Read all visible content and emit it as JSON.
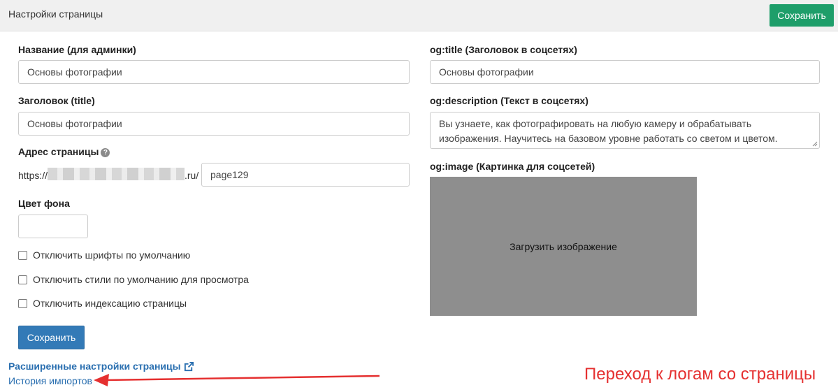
{
  "header": {
    "title": "Настройки страницы",
    "save_label": "Сохранить"
  },
  "left": {
    "name_label": "Название (для админки)",
    "name_value": "Основы фотографии",
    "title_label": "Заголовок (title)",
    "title_value": "Основы фотографии",
    "address_label": "Адрес страницы",
    "address_help_icon": "question-circle-icon",
    "url_prefix": "https://",
    "url_suffix": ".ru/",
    "slug_value": "page129",
    "bg_color_label": "Цвет фона",
    "bg_color_value": "",
    "checkboxes": [
      {
        "label": "Отключить шрифты по умолчанию",
        "checked": false
      },
      {
        "label": "Отключить стили по умолчанию для просмотра",
        "checked": false
      },
      {
        "label": "Отключить индексацию страницы",
        "checked": false
      }
    ],
    "save_label": "Сохранить"
  },
  "right": {
    "og_title_label": "og:title (Заголовок в соцсетях)",
    "og_title_value": "Основы фотографии",
    "og_description_label": "og:description (Текст в соцсетях)",
    "og_description_value": "Вы узнаете, как фотографировать на любую камеру и обрабатывать изображения. Научитесь на базовом уровне работать со светом и цветом.",
    "og_image_label": "og:image (Картинка для соцсетей)",
    "upload_label": "Загрузить изображение"
  },
  "links": {
    "advanced_settings": "Расширенные настройки страницы",
    "advanced_icon": "external-link-icon",
    "import_history": "История импортов"
  },
  "annotation": {
    "text": "Переход к логам со страницы",
    "color": "#e53030"
  },
  "colors": {
    "header_save": "#1e9e6a",
    "primary_button": "#337ab7",
    "link": "#2a6fb0",
    "image_placeholder": "#8e8e8e"
  }
}
